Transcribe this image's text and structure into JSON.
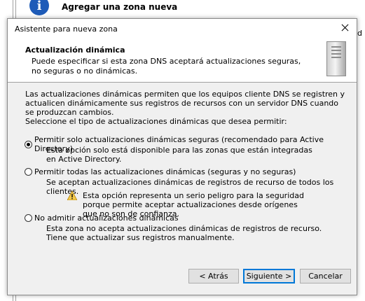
{
  "background": {
    "heading": "Agregar una zona nueva",
    "right_fragment": "d"
  },
  "dialog": {
    "title": "Asistente para nueva zona",
    "header": {
      "title": "Actualización dinámica",
      "subtitle": "Puede especificar si esta zona DNS aceptará actualizaciones seguras, no seguras o no dinámicas."
    },
    "intro": "Las actualizaciones dinámicas permiten que los equipos cliente DNS se registren y actualicen dinámicamente sus registros de recursos con un servidor DNS cuando se produzcan cambios.",
    "prompt": "Seleccione el tipo de actualizaciones dinámicas que desea permitir:",
    "options": [
      {
        "label": "Permitir solo actualizaciones dinámicas seguras (recomendado para Active Directory)",
        "description": "Esta opción solo está disponible para las zonas que están integradas en Active Directory.",
        "selected": true
      },
      {
        "label": "Permitir todas las actualizaciones dinámicas (seguras y no seguras)",
        "description": "Se aceptan actualizaciones dinámicas de registros de recurso de todos los clientes.",
        "warning": "Esta opción representa un serio peligro para la seguridad porque permite aceptar actualizaciones desde orígenes que no son de confianza.",
        "selected": false
      },
      {
        "label": "No admitir actualizaciones dinámicas",
        "description": "Esta zona no acepta actualizaciones dinámicas de registros de recurso. Tiene que actualizar sus registros manualmente.",
        "selected": false
      }
    ],
    "buttons": {
      "back": "< Atrás",
      "next": "Siguiente >",
      "cancel": "Cancelar"
    }
  },
  "icons": {
    "info": "info-icon",
    "server": "server-icon",
    "warning": "warning-icon",
    "close": "close-icon"
  },
  "colors": {
    "info_blue": "#1e5bb8",
    "focus_border": "#0078d7",
    "warning_yellow": "#f2c94c"
  }
}
